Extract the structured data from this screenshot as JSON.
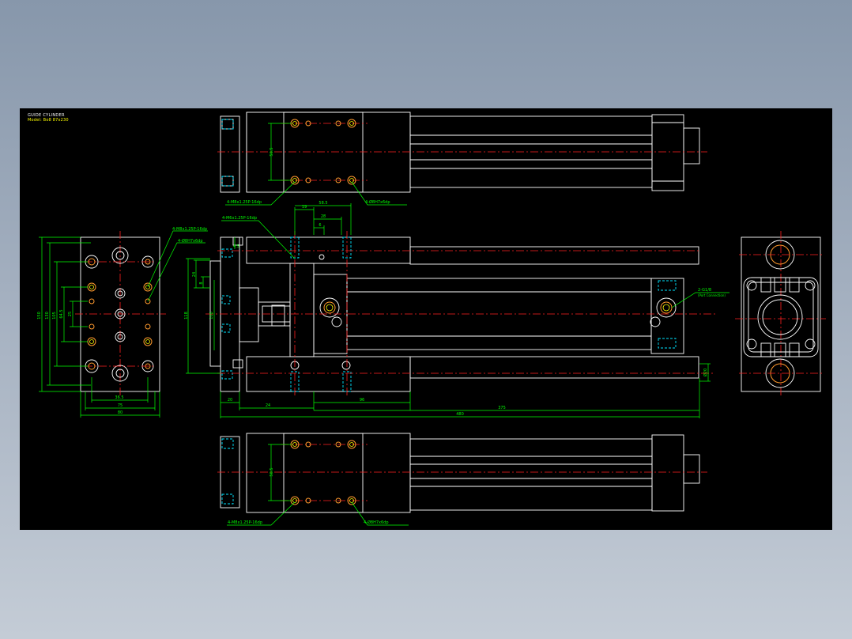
{
  "title_block": {
    "line1": "GUIDE CYLINDER",
    "line2": "Model: Bo8 87x230"
  },
  "labels": {
    "top_tap": "4-M8x1.25P-16dp",
    "top_pin": "4-Ø8H7x6dp",
    "left_tap": "4-M8x1.25P-16dp",
    "left_pin": "4-Ø8H7x6dp",
    "front_tap": "4-M6x1.25P-16dp",
    "port": "2-G1/8",
    "port_note": "(Port Connection)",
    "bottom_tap": "4-M8x1.25P-16dp",
    "bottom_pin": "4-Ø8H7x6dp"
  },
  "dims": {
    "d56_5_top": "56.5",
    "d56_5_bottom": "56.5",
    "d19": "19",
    "d58_5": "58.5",
    "d28": "28",
    "d6": "6",
    "d4_5": "4.5",
    "d24a": "24",
    "d8": "8",
    "d118": "118",
    "d100": "100",
    "d150": "150",
    "d130": "130",
    "d105": "105",
    "d64_5": "64.5",
    "d25": "25",
    "d36_5": "36.5",
    "d75": "75",
    "d80": "80",
    "d20": "20",
    "d24b": "24",
    "d96": "96",
    "d375": "375",
    "d480": "480",
    "d20_rod": "Ø20"
  }
}
